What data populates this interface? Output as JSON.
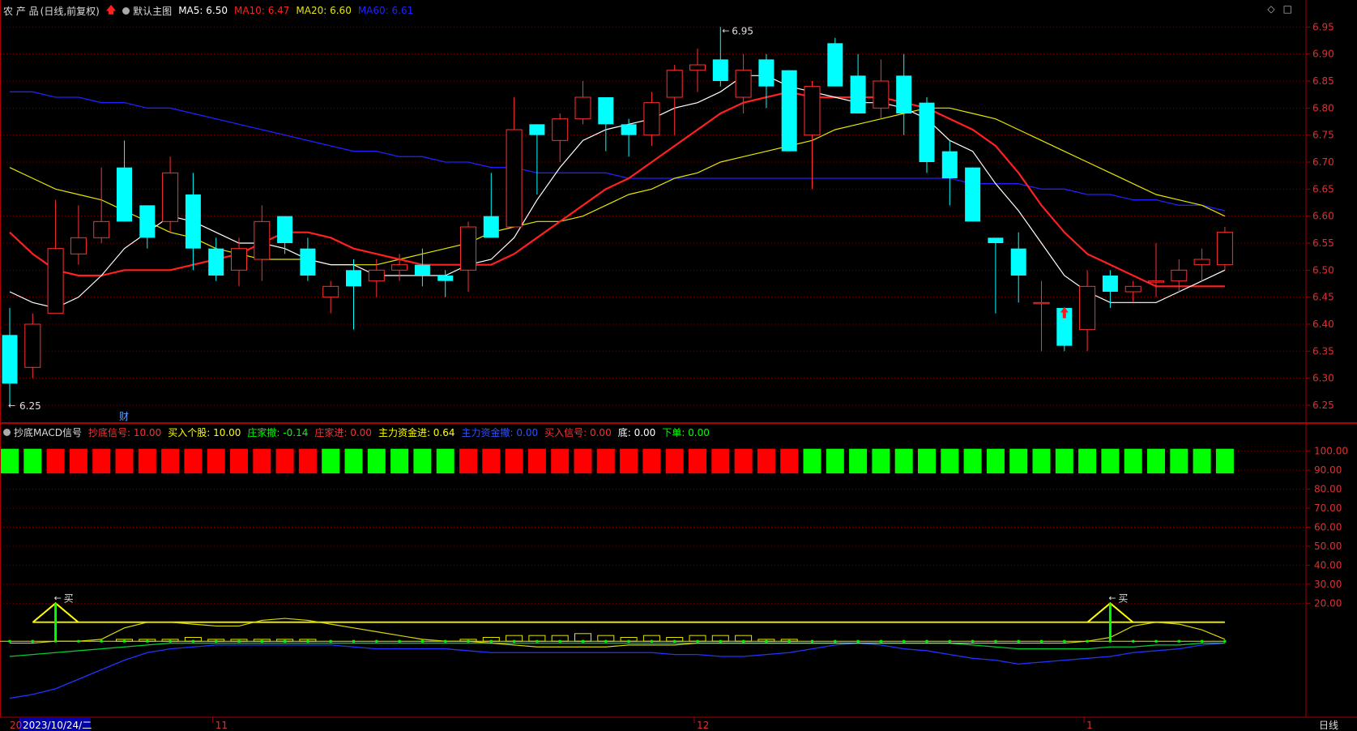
{
  "main_header": {
    "stock": "农 产 品",
    "period": "(日线,前复权)",
    "template": "默认主图",
    "ma5_label": "MA5:",
    "ma5": "6.50",
    "ma10_label": "MA10:",
    "ma10": "6.47",
    "ma20_label": "MA20:",
    "ma20": "6.60",
    "ma60_label": "MA60:",
    "ma60": "6.61"
  },
  "sub_header": {
    "indicator": "抄底MACD信号",
    "items": [
      {
        "label": "抄底信号:",
        "value": "10.00",
        "color": "#ff3030"
      },
      {
        "label": "买入个股:",
        "value": "10.00",
        "color": "#ffff00"
      },
      {
        "label": "庄家撤:",
        "value": "-0.14",
        "color": "#00ff00"
      },
      {
        "label": "庄家进:",
        "value": "0.00",
        "color": "#ff3030"
      },
      {
        "label": "主力资金进:",
        "value": "0.64",
        "color": "#ffff00"
      },
      {
        "label": "主力资金撤:",
        "value": "0.00",
        "color": "#3050ff"
      },
      {
        "label": "买入信号:",
        "value": "0.00",
        "color": "#ff3030"
      },
      {
        "label": "底:",
        "value": "0.00",
        "color": "#ffffff"
      },
      {
        "label": "下单:",
        "value": "0.00",
        "color": "#00ff00"
      }
    ]
  },
  "annotations": {
    "high": "6.95",
    "low": "6.25",
    "cai": "财",
    "buy": "买"
  },
  "x_axis": {
    "date": "2023/10/24/二",
    "m11": "11",
    "m12": "12",
    "m1": "1",
    "start": "20",
    "period_tab": "日线"
  },
  "colors": {
    "up": "#ff3030",
    "down": "#00ffff",
    "ma5": "#ffffff",
    "ma10": "#ff2020",
    "ma20": "#e6e600",
    "ma60": "#2020ff",
    "sig_red": "#ff0000",
    "sig_green": "#00ff00"
  },
  "chart_data": [
    {
      "type": "candlestick",
      "ylim": [
        6.22,
        6.97
      ],
      "y_ticks": [
        "6.95",
        "6.90",
        "6.85",
        "6.80",
        "6.75",
        "6.70",
        "6.65",
        "6.60",
        "6.55",
        "6.50",
        "6.45",
        "6.40",
        "6.35",
        "6.30",
        "6.25"
      ],
      "candles": [
        [
          6.38,
          6.29,
          6.43,
          6.25
        ],
        [
          6.32,
          6.4,
          6.42,
          6.3
        ],
        [
          6.42,
          6.54,
          6.63,
          6.42
        ],
        [
          6.53,
          6.56,
          6.62,
          6.51
        ],
        [
          6.56,
          6.59,
          6.69,
          6.55
        ],
        [
          6.69,
          6.59,
          6.74,
          6.59
        ],
        [
          6.62,
          6.56,
          6.62,
          6.54
        ],
        [
          6.59,
          6.68,
          6.71,
          6.57
        ],
        [
          6.64,
          6.54,
          6.68,
          6.5
        ],
        [
          6.54,
          6.49,
          6.56,
          6.48
        ],
        [
          6.5,
          6.54,
          6.56,
          6.47
        ],
        [
          6.52,
          6.59,
          6.62,
          6.48
        ],
        [
          6.6,
          6.55,
          6.6,
          6.53
        ],
        [
          6.54,
          6.49,
          6.56,
          6.48
        ],
        [
          6.45,
          6.47,
          6.48,
          6.42
        ],
        [
          6.5,
          6.47,
          6.52,
          6.39
        ],
        [
          6.48,
          6.5,
          6.52,
          6.45
        ],
        [
          6.5,
          6.51,
          6.53,
          6.48
        ],
        [
          6.51,
          6.49,
          6.54,
          6.47
        ],
        [
          6.49,
          6.48,
          6.5,
          6.45
        ],
        [
          6.5,
          6.58,
          6.59,
          6.46
        ],
        [
          6.6,
          6.56,
          6.68,
          6.56
        ],
        [
          6.58,
          6.76,
          6.82,
          6.58
        ],
        [
          6.77,
          6.75,
          6.77,
          6.64
        ],
        [
          6.74,
          6.78,
          6.79,
          6.7
        ],
        [
          6.78,
          6.82,
          6.85,
          6.77
        ],
        [
          6.82,
          6.77,
          6.82,
          6.72
        ],
        [
          6.77,
          6.75,
          6.78,
          6.71
        ],
        [
          6.75,
          6.81,
          6.83,
          6.73
        ],
        [
          6.82,
          6.87,
          6.88,
          6.75
        ],
        [
          6.87,
          6.88,
          6.91,
          6.83
        ],
        [
          6.89,
          6.85,
          6.95,
          6.84
        ],
        [
          6.82,
          6.87,
          6.9,
          6.79
        ],
        [
          6.89,
          6.84,
          6.9,
          6.8
        ],
        [
          6.87,
          6.72,
          6.87,
          6.72
        ],
        [
          6.75,
          6.84,
          6.85,
          6.65
        ],
        [
          6.92,
          6.84,
          6.93,
          6.84
        ],
        [
          6.86,
          6.79,
          6.9,
          6.79
        ],
        [
          6.8,
          6.85,
          6.89,
          6.78
        ],
        [
          6.86,
          6.79,
          6.9,
          6.75
        ],
        [
          6.81,
          6.7,
          6.82,
          6.68
        ],
        [
          6.72,
          6.67,
          6.74,
          6.62
        ],
        [
          6.69,
          6.59,
          6.69,
          6.59
        ],
        [
          6.56,
          6.55,
          6.56,
          6.42
        ],
        [
          6.54,
          6.49,
          6.57,
          6.44
        ],
        [
          6.44,
          6.44,
          6.48,
          6.35
        ],
        [
          6.43,
          6.36,
          6.43,
          6.35
        ],
        [
          6.39,
          6.47,
          6.5,
          6.35
        ],
        [
          6.49,
          6.46,
          6.5,
          6.43
        ],
        [
          6.46,
          6.47,
          6.48,
          6.44
        ],
        [
          6.48,
          6.48,
          6.55,
          6.45
        ],
        [
          6.48,
          6.5,
          6.52,
          6.46
        ],
        [
          6.51,
          6.52,
          6.54,
          6.48
        ],
        [
          6.51,
          6.57,
          6.58,
          6.5
        ]
      ],
      "ma5": [
        6.46,
        6.44,
        6.43,
        6.45,
        6.49,
        6.54,
        6.57,
        6.6,
        6.59,
        6.57,
        6.55,
        6.55,
        6.54,
        6.52,
        6.51,
        6.51,
        6.49,
        6.49,
        6.49,
        6.49,
        6.51,
        6.52,
        6.56,
        6.63,
        6.69,
        6.74,
        6.76,
        6.77,
        6.78,
        6.8,
        6.81,
        6.83,
        6.86,
        6.86,
        6.84,
        6.83,
        6.82,
        6.81,
        6.81,
        6.8,
        6.78,
        6.74,
        6.72,
        6.66,
        6.61,
        6.55,
        6.49,
        6.46,
        6.44,
        6.44,
        6.44,
        6.46,
        6.48,
        6.5
      ],
      "ma10": [
        6.57,
        6.53,
        6.5,
        6.49,
        6.49,
        6.5,
        6.5,
        6.5,
        6.51,
        6.52,
        6.53,
        6.55,
        6.57,
        6.57,
        6.56,
        6.54,
        6.53,
        6.52,
        6.51,
        6.51,
        6.51,
        6.51,
        6.53,
        6.56,
        6.59,
        6.62,
        6.65,
        6.67,
        6.7,
        6.73,
        6.76,
        6.79,
        6.81,
        6.82,
        6.83,
        6.82,
        6.82,
        6.82,
        6.82,
        6.81,
        6.8,
        6.78,
        6.76,
        6.73,
        6.68,
        6.62,
        6.57,
        6.53,
        6.51,
        6.49,
        6.47,
        6.47,
        6.47,
        6.47
      ],
      "ma20": [
        6.69,
        6.67,
        6.65,
        6.64,
        6.63,
        6.61,
        6.59,
        6.57,
        6.56,
        6.54,
        6.53,
        6.52,
        6.52,
        6.52,
        6.51,
        6.51,
        6.51,
        6.52,
        6.53,
        6.54,
        6.55,
        6.57,
        6.58,
        6.59,
        6.59,
        6.6,
        6.62,
        6.64,
        6.65,
        6.67,
        6.68,
        6.7,
        6.71,
        6.72,
        6.73,
        6.74,
        6.76,
        6.77,
        6.78,
        6.79,
        6.8,
        6.8,
        6.79,
        6.78,
        6.76,
        6.74,
        6.72,
        6.7,
        6.68,
        6.66,
        6.64,
        6.63,
        6.62,
        6.6
      ],
      "ma60": [
        6.83,
        6.83,
        6.82,
        6.82,
        6.81,
        6.81,
        6.8,
        6.8,
        6.79,
        6.78,
        6.77,
        6.76,
        6.75,
        6.74,
        6.73,
        6.72,
        6.72,
        6.71,
        6.71,
        6.7,
        6.7,
        6.69,
        6.69,
        6.68,
        6.68,
        6.68,
        6.68,
        6.67,
        6.67,
        6.67,
        6.67,
        6.67,
        6.67,
        6.67,
        6.67,
        6.67,
        6.67,
        6.67,
        6.67,
        6.67,
        6.67,
        6.67,
        6.66,
        6.66,
        6.66,
        6.65,
        6.65,
        6.64,
        6.64,
        6.63,
        6.63,
        6.62,
        6.62,
        6.61
      ]
    },
    {
      "type": "bar",
      "ylim": [
        -40,
        105
      ],
      "y_ticks": [
        "100.00",
        "90.00",
        "80.00",
        "70.00",
        "60.00",
        "50.00",
        "40.00",
        "30.00",
        "20.00"
      ],
      "signal_blocks": [
        "g",
        "g",
        "r",
        "r",
        "r",
        "r",
        "r",
        "r",
        "r",
        "r",
        "r",
        "r",
        "r",
        "r",
        "g",
        "g",
        "g",
        "g",
        "g",
        "g",
        "r",
        "r",
        "r",
        "r",
        "r",
        "r",
        "r",
        "r",
        "r",
        "r",
        "r",
        "r",
        "r",
        "r",
        "r",
        "g",
        "g",
        "g",
        "g",
        "g",
        "g",
        "g",
        "g",
        "g",
        "g",
        "g",
        "g",
        "g",
        "g",
        "g",
        "g",
        "g",
        "g",
        "g"
      ],
      "buy_signals": [
        2,
        48
      ],
      "buy_signal_value": 20,
      "horizontal_line": 10,
      "yellow_curve": [
        -1,
        -1,
        0,
        0,
        1,
        7,
        10,
        10,
        9,
        8,
        8,
        11,
        12,
        11,
        9,
        7,
        5,
        3,
        1,
        0,
        0,
        -1,
        -2,
        -3,
        -3,
        -3,
        -3,
        -2,
        -2,
        -2,
        -1,
        -1,
        -1,
        -1,
        -1,
        -1,
        -1,
        -1,
        -1,
        -1,
        -1,
        -1,
        -1,
        -1,
        -1,
        -1,
        -1,
        0,
        2,
        8,
        10,
        9,
        6,
        1
      ],
      "yellow_bars": [
        0,
        0,
        0,
        0,
        0,
        1,
        1,
        1,
        2,
        1,
        1,
        1,
        1,
        1,
        0,
        0,
        0,
        0,
        0,
        0,
        1,
        2,
        3,
        3,
        3,
        4,
        3,
        2,
        3,
        2,
        3,
        3,
        3,
        1,
        1,
        0,
        0,
        0,
        0,
        0,
        0,
        0,
        0,
        0,
        0,
        0,
        0,
        0,
        0,
        0,
        0,
        0,
        0,
        0
      ],
      "blue_curve": [
        -30,
        -28,
        -25,
        -20,
        -15,
        -10,
        -6,
        -4,
        -3,
        -2,
        -2,
        -2,
        -2,
        -2,
        -2,
        -3,
        -4,
        -4,
        -4,
        -4,
        -5,
        -6,
        -6,
        -6,
        -6,
        -6,
        -6,
        -6,
        -6,
        -7,
        -7,
        -8,
        -8,
        -7,
        -6,
        -4,
        -2,
        -1,
        -2,
        -4,
        -5,
        -7,
        -9,
        -10,
        -12,
        -11,
        -10,
        -9,
        -8,
        -6,
        -5,
        -4,
        -2,
        -1
      ],
      "green_curve": [
        -8,
        -7,
        -6,
        -5,
        -4,
        -3,
        -2,
        -1,
        -1,
        -1,
        -1,
        -1,
        -1,
        -1,
        -1,
        -1,
        -1,
        -1,
        -1,
        -1,
        -1,
        -1,
        -1,
        -1,
        -1,
        -1,
        -1,
        -1,
        -1,
        -1,
        -1,
        -1,
        -1,
        -1,
        -1,
        -1,
        -1,
        -1,
        -1,
        -1,
        -1,
        -1,
        -2,
        -3,
        -4,
        -4,
        -4,
        -4,
        -3,
        -3,
        -2,
        -2,
        -1,
        -1
      ]
    }
  ]
}
